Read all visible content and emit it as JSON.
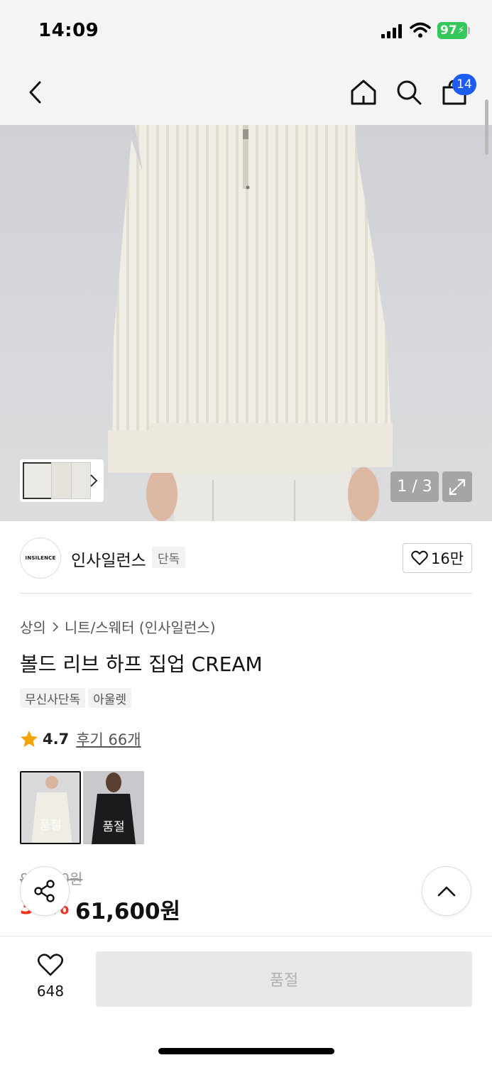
{
  "status": {
    "time": "14:09",
    "battery": "97"
  },
  "nav": {
    "cart_count": "14",
    "icons": [
      "back-icon",
      "home-icon",
      "search-icon",
      "cart-icon"
    ]
  },
  "gallery": {
    "counter": "1 / 3"
  },
  "brand": {
    "logo_text": "INSILENCE",
    "name": "인사일런스",
    "tag": "단독",
    "likes": "16만"
  },
  "product": {
    "breadcrumb": [
      "상의",
      "니트/스웨터 (인사일런스)"
    ],
    "title": "볼드 리브 하프 집업 CREAM",
    "tags": [
      "무신사단독",
      "아울렛"
    ],
    "rating": "4.7",
    "reviews": "후기 66개",
    "options": [
      {
        "label": "품절",
        "color": "#efece4"
      },
      {
        "label": "품절",
        "color": "#1b1b1d"
      }
    ],
    "original_price": "88,000원",
    "discount": "30%",
    "price": "61,600원"
  },
  "bottom": {
    "wish_count": "648",
    "button_label": "품절"
  },
  "colors": {
    "accent": "#1d5cf0",
    "sale": "#f0341d"
  }
}
